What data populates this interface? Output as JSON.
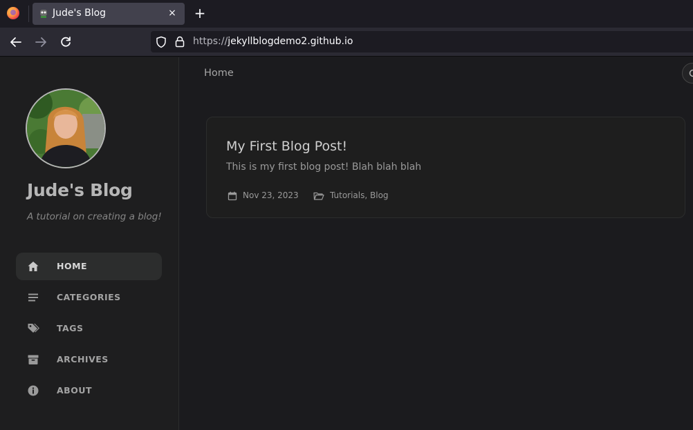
{
  "browser": {
    "tab_title": "Jude's Blog",
    "tab_close_glyph": "×",
    "new_tab_glyph": "+",
    "url_scheme": "https://",
    "url_host": "jekyllblogdemo2.github.io"
  },
  "sidebar": {
    "site_title": "Jude's Blog",
    "site_subtitle": "A tutorial on creating a blog!",
    "nav": [
      {
        "label": "HOME",
        "icon": "home-icon",
        "active": true
      },
      {
        "label": "CATEGORIES",
        "icon": "stream-icon",
        "active": false
      },
      {
        "label": "TAGS",
        "icon": "tags-icon",
        "active": false
      },
      {
        "label": "ARCHIVES",
        "icon": "archive-icon",
        "active": false
      },
      {
        "label": "ABOUT",
        "icon": "info-circle-icon",
        "active": false
      }
    ]
  },
  "main": {
    "breadcrumb": "Home",
    "posts": [
      {
        "title": "My First Blog Post!",
        "excerpt": "This is my first blog post! Blah blah blah",
        "date": "Nov 23, 2023",
        "categories": "Tutorials, Blog"
      }
    ]
  },
  "colors": {
    "page_bg": "#1b1b1e",
    "sidebar_bg": "#1e1e1f",
    "card_bg": "#1e1e1e",
    "active_nav_bg": "#2c2d2d"
  }
}
